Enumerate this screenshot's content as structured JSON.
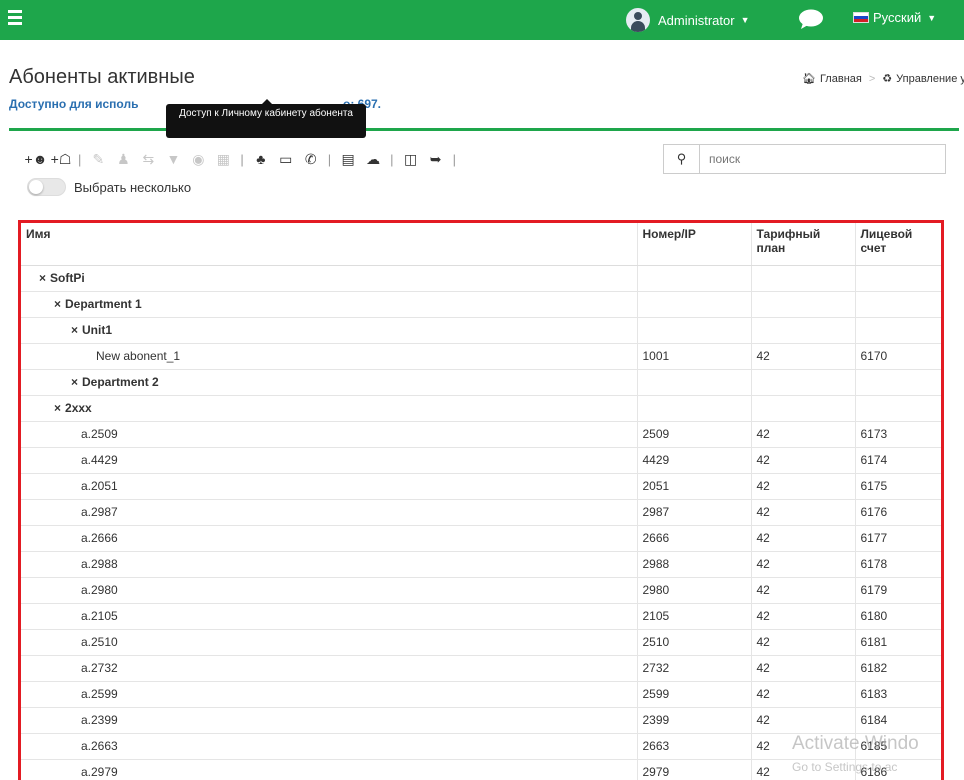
{
  "topbar": {
    "user_label": "Administrator",
    "language_label": "Русский",
    "colors": {
      "bar": "#1ea64b"
    }
  },
  "page": {
    "title": "Абоненты активные",
    "available_prefix": "Доступно для исполь",
    "available_suffix": "o: 697.",
    "tooltip": "Доступ к Личному кабинету абонента",
    "breadcrumb": {
      "home": "Главная",
      "nodes": "Управление узлами"
    }
  },
  "toolbar": {
    "icons": [
      "add-user-icon",
      "add-group-icon",
      "edit-icon",
      "user-settings-icon",
      "transfer-icon",
      "filter-off-icon",
      "globe-icon",
      "trash-icon",
      "group-icon",
      "monitor-icon",
      "phone-icon",
      "file-icon",
      "cloud-upload-icon",
      "columns-icon",
      "export-icon"
    ]
  },
  "search": {
    "placeholder": "поиск"
  },
  "multi_select": {
    "label": "Выбрать несколько"
  },
  "table": {
    "headers": {
      "name": "Имя",
      "number": "Номер/IP",
      "tariff": "Тарифный план",
      "account": "Лицевой счет"
    },
    "rows": [
      {
        "type": "group",
        "indent": 1,
        "name": "SoftPi",
        "number": "",
        "tariff": "",
        "account": ""
      },
      {
        "type": "group",
        "indent": 2,
        "name": "Department 1",
        "number": "",
        "tariff": "",
        "account": ""
      },
      {
        "type": "group",
        "indent": 3,
        "name": "Unit1",
        "number": "",
        "tariff": "",
        "account": ""
      },
      {
        "type": "item",
        "indent": 4,
        "name": "New abonent_1",
        "number": "1001",
        "tariff": "42",
        "account": "6170"
      },
      {
        "type": "group",
        "indent": 3,
        "name": "Department 2",
        "number": "",
        "tariff": "",
        "account": ""
      },
      {
        "type": "group",
        "indent": 2,
        "name": "2xxx",
        "number": "",
        "tariff": "",
        "account": ""
      },
      {
        "type": "item",
        "indent": 3,
        "name": "a.2509",
        "number": "2509",
        "tariff": "42",
        "account": "6173"
      },
      {
        "type": "item",
        "indent": 3,
        "name": "a.4429",
        "number": "4429",
        "tariff": "42",
        "account": "6174"
      },
      {
        "type": "item",
        "indent": 3,
        "name": "a.2051",
        "number": "2051",
        "tariff": "42",
        "account": "6175"
      },
      {
        "type": "item",
        "indent": 3,
        "name": "a.2987",
        "number": "2987",
        "tariff": "42",
        "account": "6176"
      },
      {
        "type": "item",
        "indent": 3,
        "name": "a.2666",
        "number": "2666",
        "tariff": "42",
        "account": "6177"
      },
      {
        "type": "item",
        "indent": 3,
        "name": "a.2988",
        "number": "2988",
        "tariff": "42",
        "account": "6178"
      },
      {
        "type": "item",
        "indent": 3,
        "name": "a.2980",
        "number": "2980",
        "tariff": "42",
        "account": "6179"
      },
      {
        "type": "item",
        "indent": 3,
        "name": "a.2105",
        "number": "2105",
        "tariff": "42",
        "account": "6180"
      },
      {
        "type": "item",
        "indent": 3,
        "name": "a.2510",
        "number": "2510",
        "tariff": "42",
        "account": "6181"
      },
      {
        "type": "item",
        "indent": 3,
        "name": "a.2732",
        "number": "2732",
        "tariff": "42",
        "account": "6182"
      },
      {
        "type": "item",
        "indent": 3,
        "name": "a.2599",
        "number": "2599",
        "tariff": "42",
        "account": "6183"
      },
      {
        "type": "item",
        "indent": 3,
        "name": "a.2399",
        "number": "2399",
        "tariff": "42",
        "account": "6184"
      },
      {
        "type": "item",
        "indent": 3,
        "name": "a.2663",
        "number": "2663",
        "tariff": "42",
        "account": "6185"
      },
      {
        "type": "item",
        "indent": 3,
        "name": "a.2979",
        "number": "2979",
        "tariff": "42",
        "account": "6186"
      }
    ]
  },
  "watermark": {
    "line1": "Activate Windo",
    "line2": "Go to Settings to ac"
  }
}
